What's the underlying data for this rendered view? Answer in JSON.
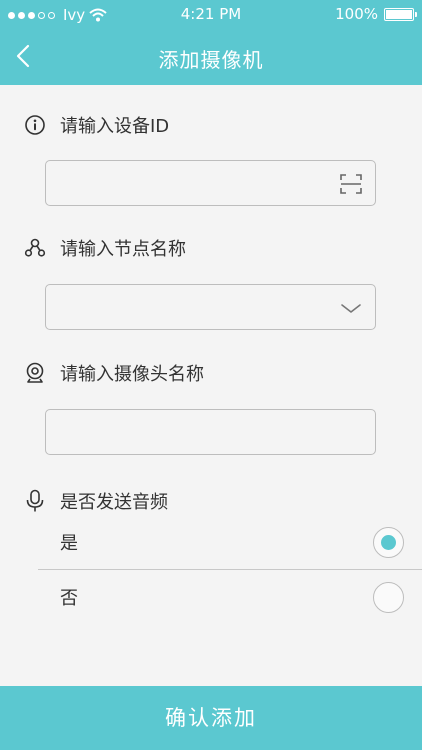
{
  "status_bar": {
    "carrier": "Ivy",
    "time": "4:21 PM",
    "battery": "100%"
  },
  "header": {
    "title": "添加摄像机",
    "back_icon": "chevron-left-icon"
  },
  "fields": {
    "device_id": {
      "label": "请输入设备ID",
      "icon": "info-icon",
      "value": "",
      "action_icon": "scan-icon"
    },
    "node_name": {
      "label": "请输入节点名称",
      "icon": "node-icon",
      "selected": "",
      "action_icon": "chevron-down-icon"
    },
    "camera_name": {
      "label": "请输入摄像头名称",
      "icon": "webcam-icon",
      "value": ""
    }
  },
  "send_audio": {
    "label": "是否发送音频",
    "icon": "microphone-icon",
    "options": [
      {
        "label": "是",
        "checked": true
      },
      {
        "label": "否",
        "checked": false
      }
    ]
  },
  "confirm_button": {
    "label": "确认添加"
  },
  "colors": {
    "accent": "#5bc8d0",
    "background": "#f4f4f4"
  }
}
